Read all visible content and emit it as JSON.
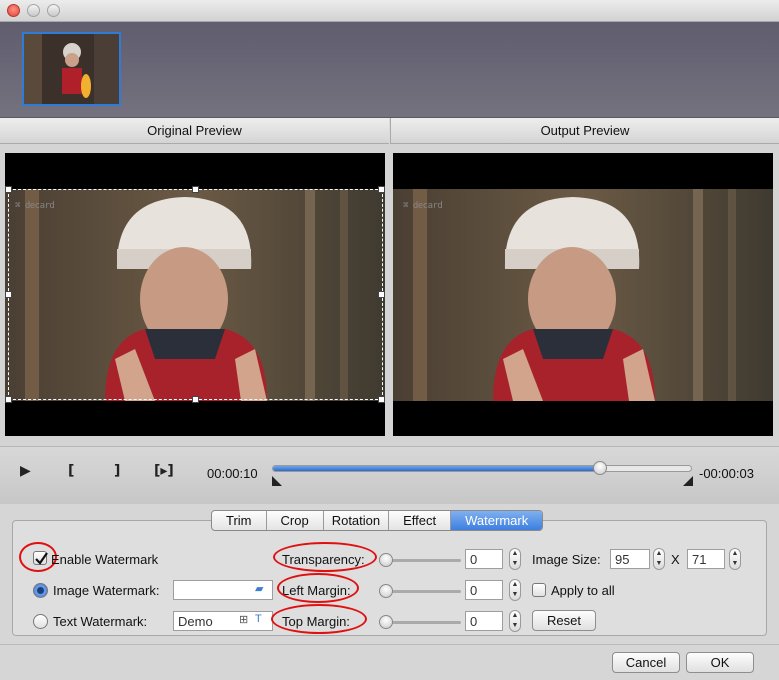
{
  "window": {
    "title": ""
  },
  "thumbnail": {
    "icon": "video-thumbnail"
  },
  "preview": {
    "original_label": "Original Preview",
    "output_label": "Output Preview",
    "watermark_logo": "⌘ decard"
  },
  "playback": {
    "current_time": "00:00:10",
    "remaining_time": "-00:00:03",
    "progress": 0.78,
    "play_icon": "▶",
    "mark_in_icon": "[",
    "mark_out_icon": "]",
    "step_icon": "[▸]"
  },
  "tabs": [
    {
      "label": "Trim"
    },
    {
      "label": "Crop"
    },
    {
      "label": "Rotation"
    },
    {
      "label": "Effect"
    },
    {
      "label": "Watermark",
      "active": true
    }
  ],
  "watermark": {
    "enable_label": "Enable Watermark",
    "enable_checked": true,
    "image_label": "Image Watermark:",
    "image_value": "",
    "text_label": "Text Watermark:",
    "text_value": "Demo",
    "transparency_label": "Transparency:",
    "transparency_value": "0",
    "left_margin_label": "Left Margin:",
    "left_margin_value": "0",
    "top_margin_label": "Top  Margin:",
    "top_margin_value": "0",
    "image_size_label": "Image Size:",
    "image_width": "95",
    "size_x": "X",
    "image_height": "71",
    "apply_all_label": "Apply to all",
    "reset_label": "Reset"
  },
  "footer": {
    "cancel_label": "Cancel",
    "ok_label": "OK"
  },
  "colors": {
    "accent": "#3d7fe0",
    "annotation": "#e01010"
  }
}
